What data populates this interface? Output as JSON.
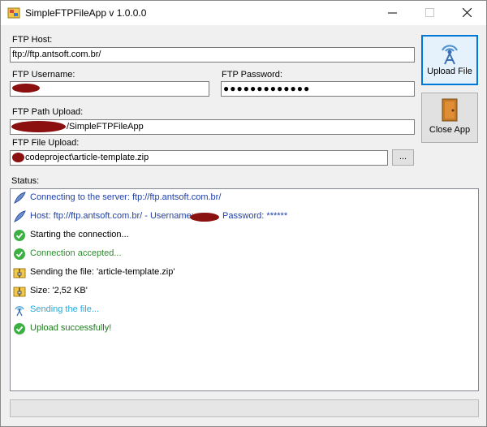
{
  "window": {
    "title": "SimpleFTPFileApp v 1.0.0.0",
    "icons": {
      "app": "app-icon",
      "minimize": "minimize-icon",
      "maximize": "maximize-icon",
      "close": "close-icon"
    }
  },
  "form": {
    "host_label": "FTP Host:",
    "host_value": "ftp://ftp.antsoft.com.br/",
    "username_label": "FTP Username:",
    "username_value": "",
    "password_label": "FTP Password:",
    "password_value": "●●●●●●●●●●●●●",
    "path_label": "FTP Path Upload:",
    "path_value": "/SimpleFTPFileApp",
    "file_label": "FTP File Upload:",
    "file_value": "codeproject\\article-template.zip",
    "browse_label": "..."
  },
  "buttons": {
    "upload_label": "Upload File",
    "upload_icon": "ftp-tower-icon",
    "close_label": "Close App",
    "close_icon": "door-icon"
  },
  "status": {
    "label": "Status:",
    "items": [
      {
        "text": "Connecting to the server: ftp://ftp.antsoft.com.br/",
        "color": "#1f3fa8",
        "icon": "feather-icon"
      },
      {
        "text_before": "Host: ftp://ftp.antsoft.com.br/ - Username:",
        "text_after": "Password: ******",
        "color": "#1f3fa8",
        "icon": "feather-icon"
      },
      {
        "text": "Starting the connection...",
        "color": "#000000",
        "icon": "check-icon"
      },
      {
        "text": "Connection accepted...",
        "color": "#2e8b2e",
        "icon": "check-icon"
      },
      {
        "text": "Sending the file: 'article-template.zip'",
        "color": "#000000",
        "icon": "file-zip-icon"
      },
      {
        "text": "Size: '2,52 KB'",
        "color": "#000000",
        "icon": "file-zip-icon"
      },
      {
        "text": "Sending the file...",
        "color": "#29a8d8",
        "icon": "ftp-tower-icon"
      },
      {
        "text": "Upload successfully!",
        "color": "#1e7b1e",
        "icon": "check-icon"
      }
    ]
  },
  "progress": {
    "value": 0
  }
}
